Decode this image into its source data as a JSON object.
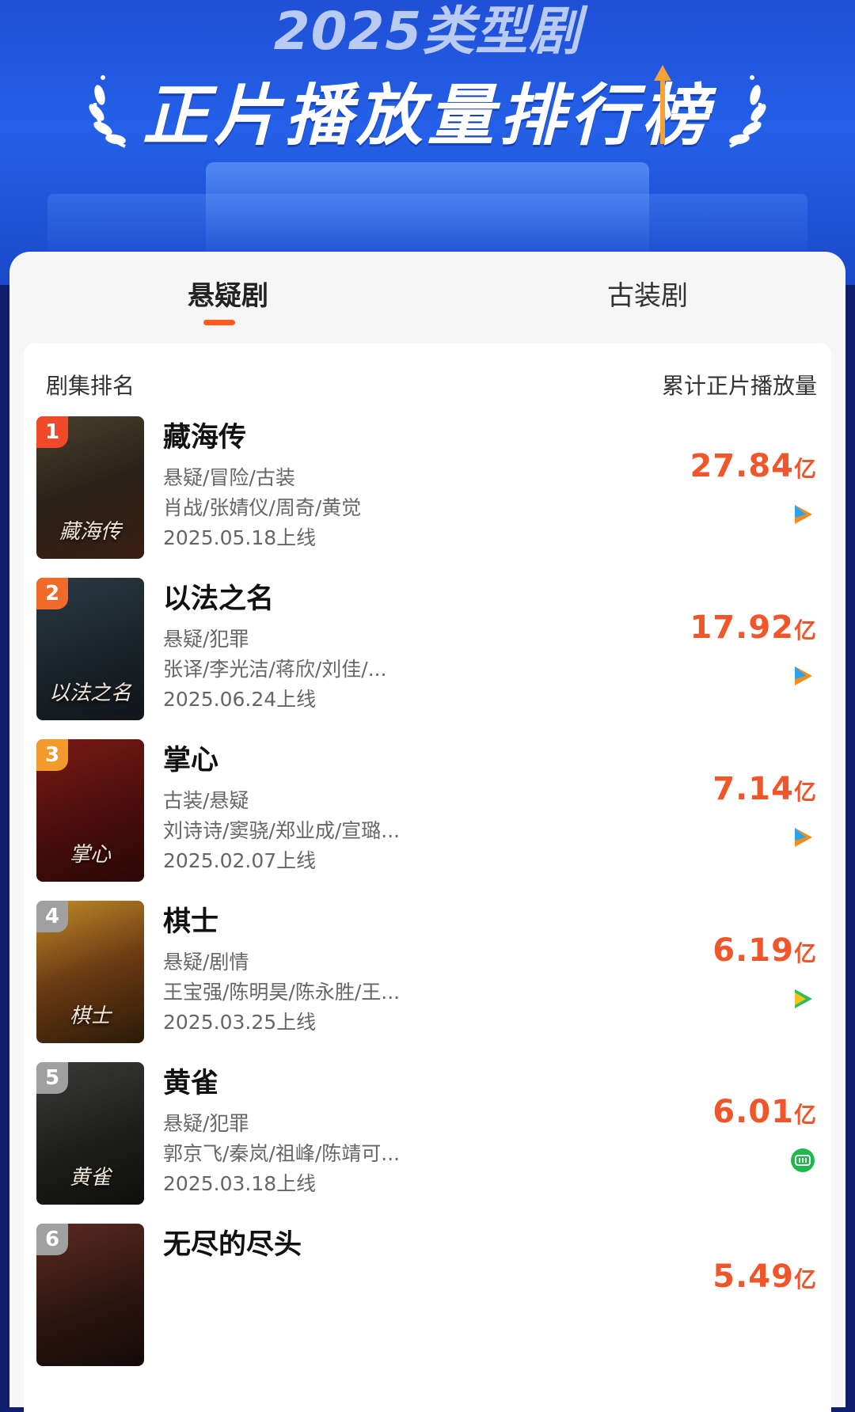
{
  "header": {
    "year_title": "2025类型剧",
    "main_title": "正片播放量排行榜"
  },
  "tabs": [
    {
      "label": "悬疑剧",
      "active": true
    },
    {
      "label": "古装剧",
      "active": false
    }
  ],
  "list_header": {
    "left": "剧集排名",
    "right": "累计正片播放量"
  },
  "colors": {
    "accent": "#f0562a",
    "tab_indicator": "#ff5a1f",
    "hero_blue": "#2460e8"
  },
  "items": [
    {
      "rank": "1",
      "title": "藏海传",
      "poster_text": "藏海传",
      "genres": "悬疑/冒险/古装",
      "cast": "肖战/张婧仪/周奇/黄觉",
      "release": "2025.05.18上线",
      "plays": "27.84",
      "unit": "亿",
      "platform_icon": "tencent-video-icon",
      "rank_color": "#f04a2a"
    },
    {
      "rank": "2",
      "title": "以法之名",
      "poster_text": "以法之名",
      "genres": "悬疑/犯罪",
      "cast": "张译/李光洁/蒋欣/刘佳/...",
      "release": "2025.06.24上线",
      "plays": "17.92",
      "unit": "亿",
      "platform_icon": "tencent-video-icon",
      "rank_color": "#f06a2a"
    },
    {
      "rank": "3",
      "title": "掌心",
      "poster_text": "掌心",
      "genres": "古装/悬疑",
      "cast": "刘诗诗/窦骁/郑业成/宣璐...",
      "release": "2025.02.07上线",
      "plays": "7.14",
      "unit": "亿",
      "platform_icon": "tencent-video-icon",
      "rank_color": "#f39a2c"
    },
    {
      "rank": "4",
      "title": "棋士",
      "poster_text": "棋士",
      "genres": "悬疑/剧情",
      "cast": "王宝强/陈明昊/陈永胜/王...",
      "release": "2025.03.25上线",
      "plays": "6.19",
      "unit": "亿",
      "platform_icon": "tencent-video-alt-icon",
      "rank_color": "#9a9a9a"
    },
    {
      "rank": "5",
      "title": "黄雀",
      "poster_text": "黄雀",
      "genres": "悬疑/犯罪",
      "cast": "郭京飞/秦岚/祖峰/陈靖可...",
      "release": "2025.03.18上线",
      "plays": "6.01",
      "unit": "亿",
      "platform_icon": "iqiyi-icon",
      "rank_color": "#9a9a9a"
    },
    {
      "rank": "6",
      "title": "无尽的尽头",
      "poster_text": "",
      "genres": "",
      "cast": "",
      "release": "",
      "plays": "5.49",
      "unit": "亿",
      "platform_icon": "",
      "rank_color": "#9a9a9a"
    }
  ]
}
